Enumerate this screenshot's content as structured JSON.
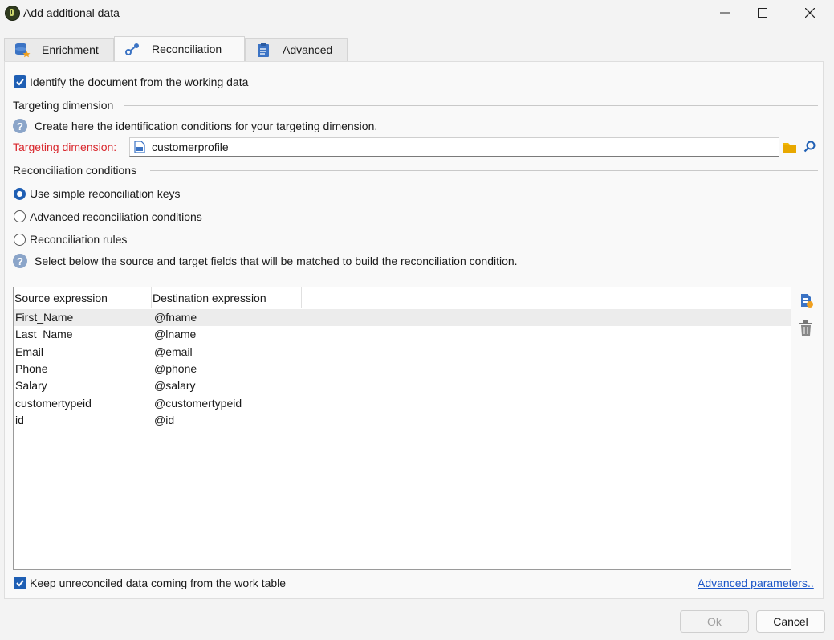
{
  "window": {
    "title": "Add additional data"
  },
  "tabs": [
    {
      "label": "Enrichment",
      "icon": "database-star-icon"
    },
    {
      "label": "Reconciliation",
      "icon": "link-nodes-icon"
    },
    {
      "label": "Advanced",
      "icon": "clipboard-icon"
    }
  ],
  "identify_checkbox": {
    "label": "Identify the document from the working data",
    "checked": true
  },
  "targeting": {
    "section_title": "Targeting dimension",
    "help_text": "Create here the identification conditions for your targeting dimension.",
    "field_label": "Targeting dimension:",
    "field_value": "customerprofile"
  },
  "reconciliation": {
    "section_title": "Reconciliation conditions",
    "options": [
      {
        "label": "Use simple reconciliation keys",
        "selected": true
      },
      {
        "label": "Advanced reconciliation conditions",
        "selected": false
      },
      {
        "label": "Reconciliation rules",
        "selected": false
      }
    ],
    "help_text": "Select below the source and target fields that will be matched to build the reconciliation condition."
  },
  "table": {
    "headers": [
      "Source expression",
      "Destination expression"
    ],
    "rows": [
      [
        "First_Name",
        "@fname"
      ],
      [
        "Last_Name",
        "@lname"
      ],
      [
        "Email",
        "@email"
      ],
      [
        "Phone",
        "@phone"
      ],
      [
        "Salary",
        "@salary"
      ],
      [
        "customertypeid",
        "@customertypeid"
      ],
      [
        "id",
        "@id"
      ]
    ]
  },
  "keep_checkbox": {
    "label": "Keep unreconciled data coming from the work table",
    "checked": true
  },
  "advanced_link": "Advanced parameters..",
  "buttons": {
    "ok": "Ok",
    "cancel": "Cancel"
  },
  "colors": {
    "accent": "#1f5fb4",
    "required_label": "#d9262c",
    "link": "#1a55c8"
  }
}
